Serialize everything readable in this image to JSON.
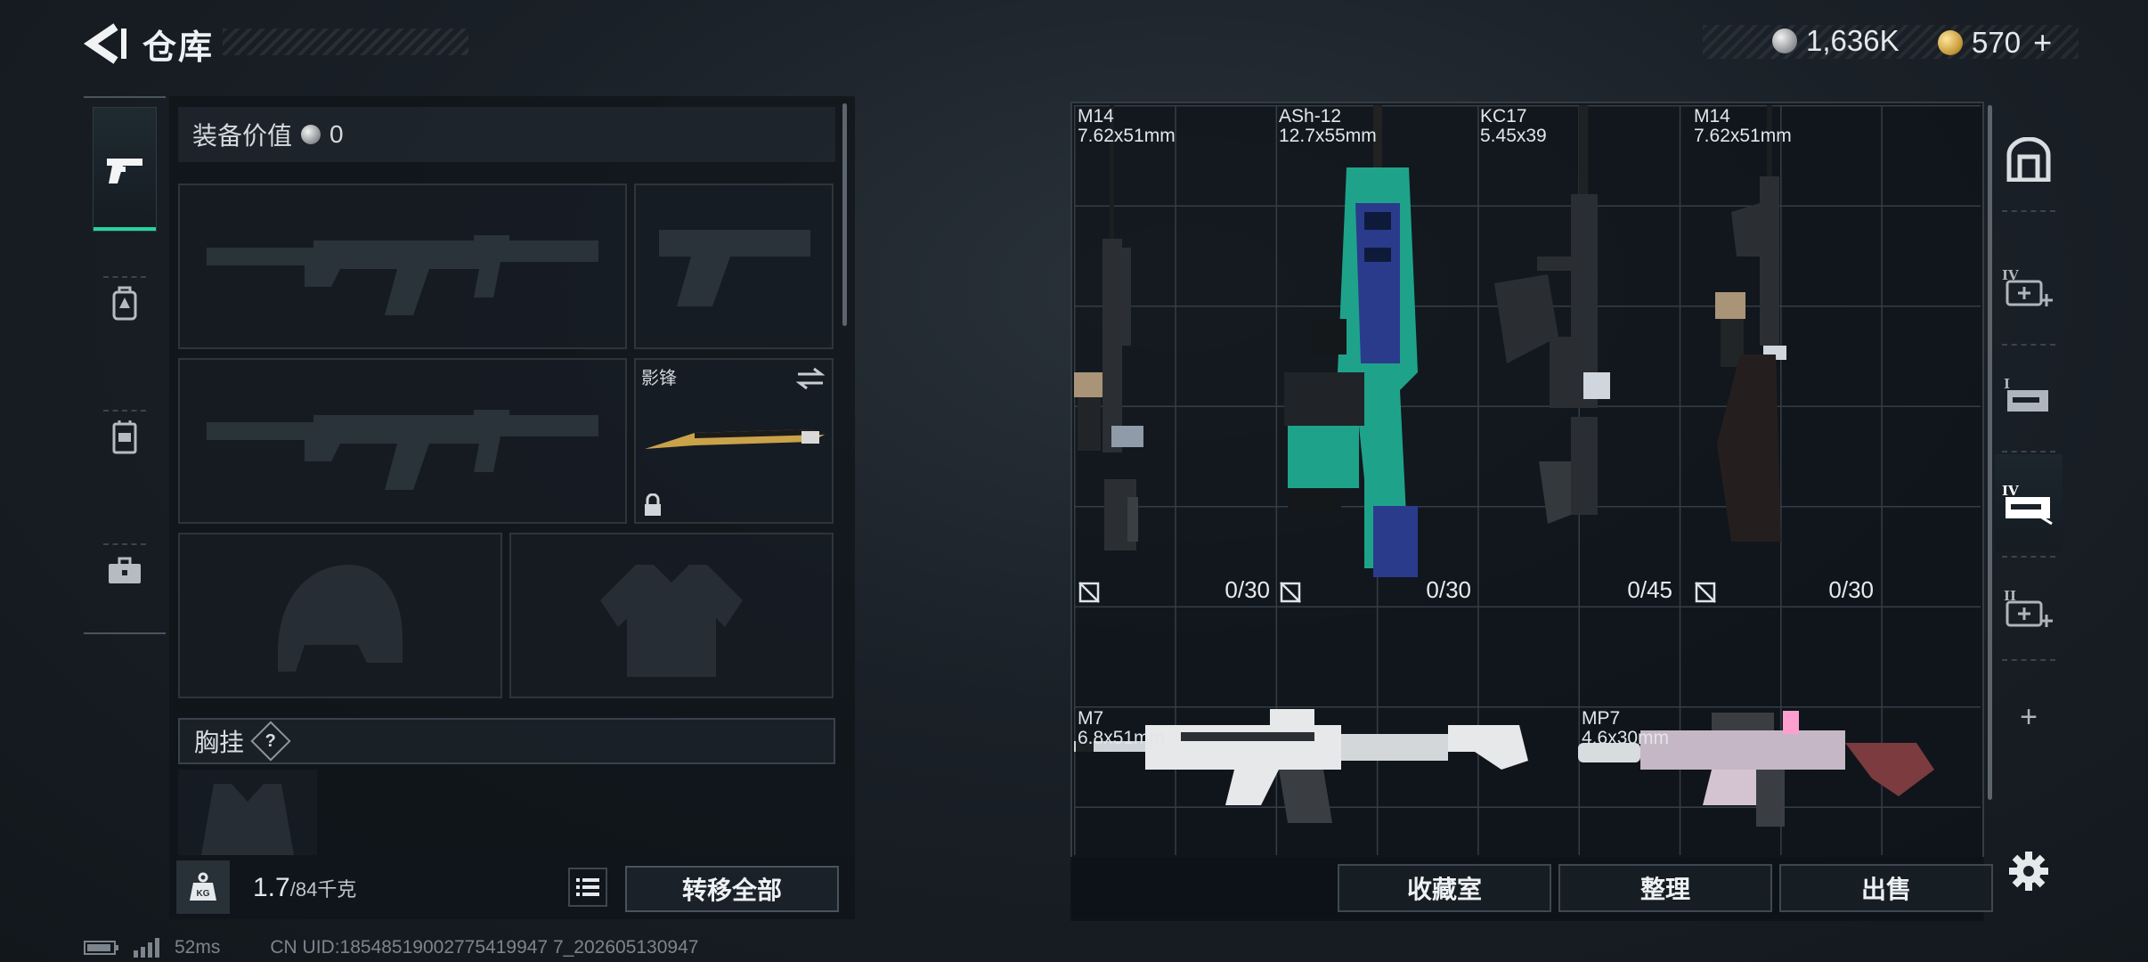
{
  "header": {
    "title": "仓库",
    "currencies": [
      {
        "icon": "silver-coin-icon",
        "value": "1,636K"
      },
      {
        "icon": "gold-coin-icon",
        "value": "570"
      }
    ],
    "plus_label": "+"
  },
  "left_tabs": [
    {
      "icon": "pistol-icon",
      "active": true
    },
    {
      "icon": "backpack-icon",
      "active": false
    },
    {
      "icon": "vest-icon",
      "active": false
    },
    {
      "icon": "toolbox-icon",
      "active": false
    }
  ],
  "equipment": {
    "value_label": "装备价值",
    "value_icon": "silver-coin-icon",
    "value": "0",
    "melee_label": "影锋",
    "chest_label": "胸挂",
    "help_label": "?",
    "weight_current": "1.7",
    "weight_max": "/84千克",
    "weight_icon": "kg-weight-icon",
    "transfer_all_label": "转移全部"
  },
  "storage_items": [
    {
      "name": "M14",
      "caliber": "7.62x51mm",
      "ammo": "0/30"
    },
    {
      "name": "ASh-12",
      "caliber": "12.7x55mm",
      "ammo": "0/30"
    },
    {
      "name": "KC17",
      "caliber": "5.45x39",
      "ammo": "0/45"
    },
    {
      "name": "M14",
      "caliber": "7.62x51mm",
      "ammo": "0/30"
    },
    {
      "name": "M7",
      "caliber": "6.8x51mm",
      "ammo": ""
    },
    {
      "name": "MP7",
      "caliber": "4.6x30mm",
      "ammo": ""
    }
  ],
  "bottom_buttons": {
    "collection": "收藏室",
    "organize": "整理",
    "sell": "出售"
  },
  "right_tabs": [
    {
      "icon": "safe-box-icon"
    },
    {
      "icon": "level-4-medkit-add-icon"
    },
    {
      "icon": "level-1-weapon-case-icon"
    },
    {
      "icon": "level-4-weapon-case-icon",
      "active": true
    },
    {
      "icon": "level-2-medkit-add-icon"
    },
    {
      "icon": "add-icon",
      "label": "+"
    },
    {
      "icon": "settings-gear-icon"
    }
  ],
  "status_bar": {
    "ping": "52ms",
    "uid": "CN UID:18548519002775419947 7_202605130947"
  },
  "colors": {
    "accent": "#27d3a1",
    "panel": "#0e1318",
    "border": "#333c45"
  }
}
